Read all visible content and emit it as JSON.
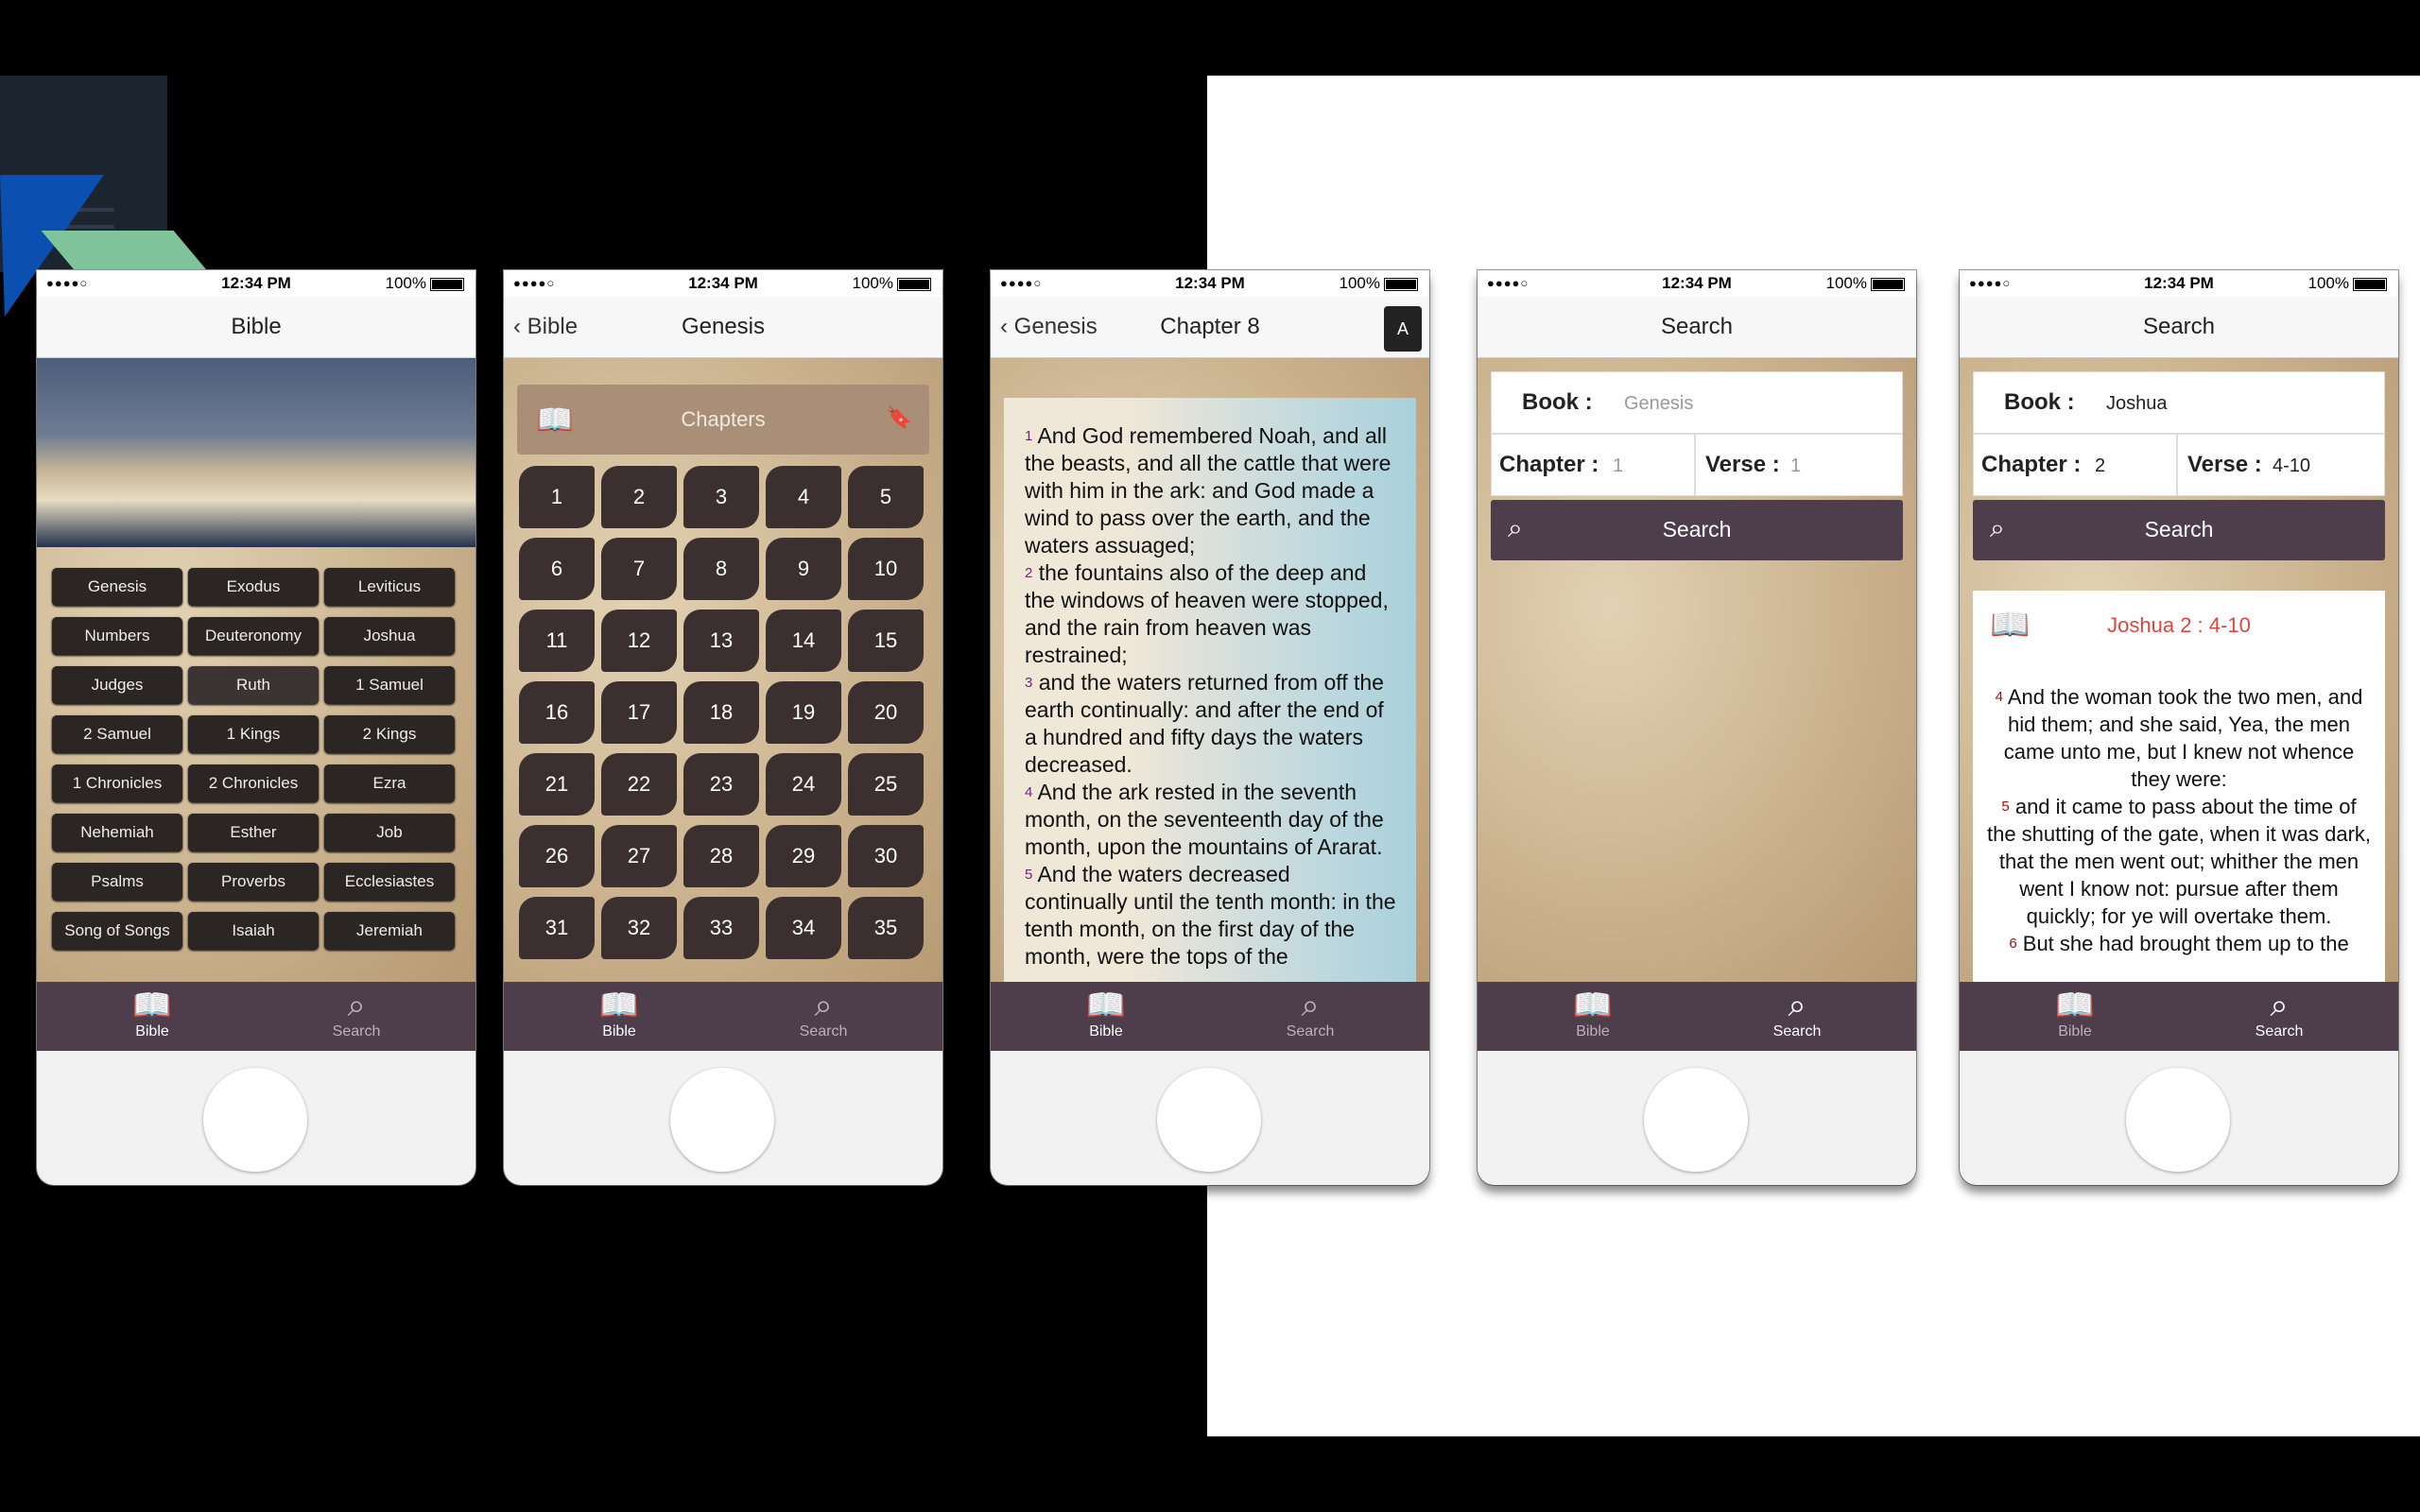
{
  "statusbar": {
    "signal": "●●●●○",
    "time": "12:34 PM",
    "battery": "100%"
  },
  "tabs": {
    "bible": "Bible",
    "search": "Search"
  },
  "screen1": {
    "title": "Bible",
    "books": [
      "Genesis",
      "Exodus",
      "Leviticus",
      "Numbers",
      "Deuteronomy",
      "Joshua",
      "Judges",
      "Ruth",
      "1 Samuel",
      "2 Samuel",
      "1 Kings",
      "2 Kings",
      "1 Chronicles",
      "2 Chronicles",
      "Ezra",
      "Nehemiah",
      "Esther",
      "Job",
      "Psalms",
      "Proverbs",
      "Ecclesiastes",
      "Song of Songs",
      "Isaiah",
      "Jeremiah"
    ]
  },
  "screen2": {
    "back": "Bible",
    "title": "Genesis",
    "section": "Chapters",
    "chapters": [
      "1",
      "2",
      "3",
      "4",
      "5",
      "6",
      "7",
      "8",
      "9",
      "10",
      "11",
      "12",
      "13",
      "14",
      "15",
      "16",
      "17",
      "18",
      "19",
      "20",
      "21",
      "22",
      "23",
      "24",
      "25",
      "26",
      "27",
      "28",
      "29",
      "30",
      "31",
      "32",
      "33",
      "34",
      "35"
    ]
  },
  "screen3": {
    "back": "Genesis",
    "title": "Chapter 8",
    "font_button": "A",
    "verses": [
      {
        "n": "1",
        "text": "And God remembered Noah, and all the beasts, and all the cattle that were with him in the ark: and God made a wind to pass over the earth, and the waters assuaged;"
      },
      {
        "n": "2",
        "text": "the fountains also of the deep and the windows of heaven were stopped, and the rain from heaven was restrained;"
      },
      {
        "n": "3",
        "text": "and the waters returned from off the earth continually: and after the end of a hundred and fifty days the waters decreased."
      },
      {
        "n": "4",
        "text": "And the ark rested in the seventh month, on the seventeenth day of the month, upon the mountains of Ararat."
      },
      {
        "n": "5",
        "text": "And the waters decreased continually until the tenth month: in the tenth month, on the first day of the month, were the tops of the"
      }
    ]
  },
  "screen4": {
    "title": "Search",
    "book_label": "Book :",
    "book_placeholder": "Genesis",
    "chapter_label": "Chapter :",
    "chapter_placeholder": "1",
    "verse_label": "Verse :",
    "verse_placeholder": "1",
    "search_button": "Search"
  },
  "screen5": {
    "title": "Search",
    "book_label": "Book :",
    "book_value": "Joshua",
    "chapter_label": "Chapter :",
    "chapter_value": "2",
    "verse_label": "Verse :",
    "verse_value": "4-10",
    "search_button": "Search",
    "result_ref": "Joshua 2 : 4-10",
    "verses": [
      {
        "n": "4",
        "text": "And the woman took the two men, and hid them; and she said, Yea, the men came unto me, but I knew not whence they were:"
      },
      {
        "n": "5",
        "text": "and it came to pass about the time of the shutting of the gate, when it was dark, that the men went out; whither the men went I know not: pursue after them quickly; for ye will overtake them."
      },
      {
        "n": "6",
        "text": "But she had brought them up to the"
      }
    ]
  }
}
